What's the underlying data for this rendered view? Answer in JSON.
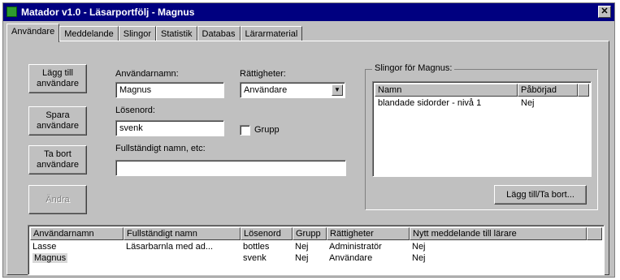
{
  "window": {
    "title": "Matador v1.0 - Läsarportfölj - Magnus"
  },
  "tabs": [
    {
      "label": "Användare",
      "active": true
    },
    {
      "label": "Meddelande"
    },
    {
      "label": "Slingor"
    },
    {
      "label": "Statistik"
    },
    {
      "label": "Databas"
    },
    {
      "label": "Lärarmaterial"
    }
  ],
  "buttons": {
    "add_user": {
      "line1": "Lägg till",
      "line2": "användare"
    },
    "save_user": {
      "line1": "Spara",
      "line2": "användare"
    },
    "delete_user": {
      "line1": "Ta bort",
      "line2": "användare"
    },
    "disabled": {
      "label": "Ändra"
    },
    "add_remove": {
      "label": "Lägg till/Ta bort..."
    }
  },
  "form": {
    "username_label": "Användarnamn:",
    "username_value": "Magnus",
    "password_label": "Lösenord:",
    "password_value": "svenk",
    "fullname_label": "Fullständigt namn, etc:",
    "fullname_value": "",
    "rights_label": "Rättigheter:",
    "rights_value": "Användare",
    "group_label": "Grupp",
    "group_checked": false
  },
  "slingor_group": {
    "title": "Slingor för Magnus:",
    "headers": [
      "Namn",
      "Påbörjad"
    ],
    "rows": [
      {
        "name": "blandade sidorder - nivå 1",
        "started": "Nej"
      }
    ]
  },
  "user_table": {
    "headers": [
      "Användarnamn",
      "Fullständigt namn",
      "Lösenord",
      "Grupp",
      "Rättigheter",
      "Nytt meddelande till lärare"
    ],
    "rows": [
      {
        "username": "Lasse",
        "fullname": "Läsarbarnla med ad...",
        "password": "bottles",
        "group": "Nej",
        "rights": "Administratör",
        "new_msg": "Nej",
        "selected": false
      },
      {
        "username": "Magnus",
        "fullname": "",
        "password": "svenk",
        "group": "Nej",
        "rights": "Användare",
        "new_msg": "Nej",
        "selected": true
      }
    ]
  },
  "colors": {
    "titlebar": "#000080",
    "face": "#c0c0c0",
    "app_icon": "#2e9b2e"
  },
  "icons": {
    "app": "matador-app-icon",
    "close": "close-icon",
    "dropdown": "chevron-down-icon"
  }
}
